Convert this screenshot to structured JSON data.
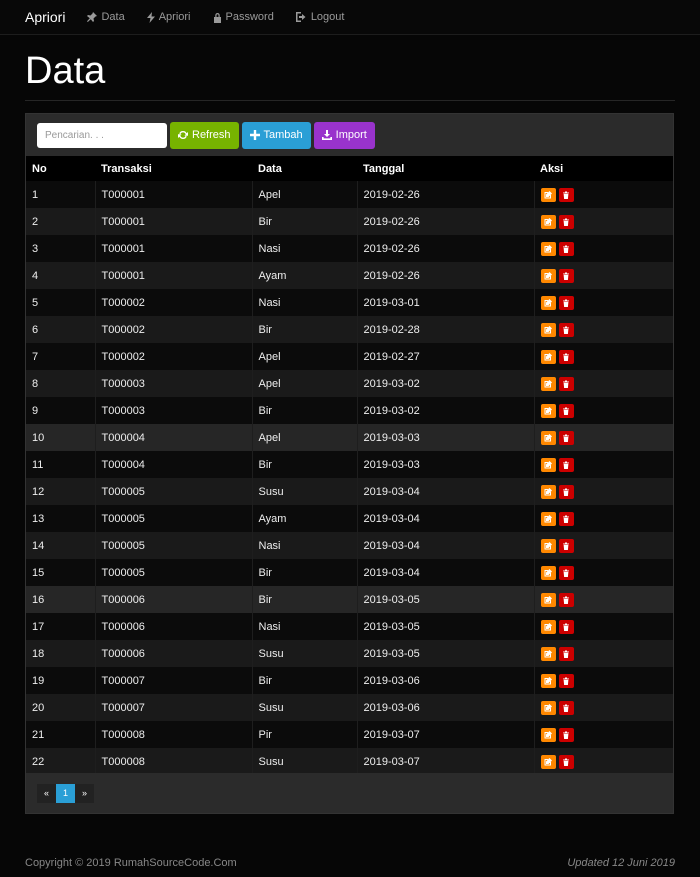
{
  "nav": {
    "brand": "Apriori",
    "items": [
      {
        "label": "Data",
        "icon": "pin-icon"
      },
      {
        "label": "Apriori",
        "icon": "flash-icon"
      },
      {
        "label": "Password",
        "icon": "lock-icon"
      },
      {
        "label": "Logout",
        "icon": "logout-icon"
      }
    ]
  },
  "page": {
    "title": "Data"
  },
  "toolbar": {
    "search_placeholder": "Pencarian. . .",
    "refresh_label": "Refresh",
    "tambah_label": "Tambah",
    "import_label": "Import"
  },
  "table": {
    "headers": [
      "No",
      "Transaksi",
      "Data",
      "Tanggal",
      "Aksi"
    ],
    "rows": [
      [
        "1",
        "T000001",
        "Apel",
        "2019-02-26"
      ],
      [
        "2",
        "T000001",
        "Bir",
        "2019-02-26"
      ],
      [
        "3",
        "T000001",
        "Nasi",
        "2019-02-26"
      ],
      [
        "4",
        "T000001",
        "Ayam",
        "2019-02-26"
      ],
      [
        "5",
        "T000002",
        "Nasi",
        "2019-03-01"
      ],
      [
        "6",
        "T000002",
        "Bir",
        "2019-02-28"
      ],
      [
        "7",
        "T000002",
        "Apel",
        "2019-02-27"
      ],
      [
        "8",
        "T000003",
        "Apel",
        "2019-03-02"
      ],
      [
        "9",
        "T000003",
        "Bir",
        "2019-03-02"
      ],
      [
        "10",
        "T000004",
        "Apel",
        "2019-03-03"
      ],
      [
        "11",
        "T000004",
        "Bir",
        "2019-03-03"
      ],
      [
        "12",
        "T000005",
        "Susu",
        "2019-03-04"
      ],
      [
        "13",
        "T000005",
        "Ayam",
        "2019-03-04"
      ],
      [
        "14",
        "T000005",
        "Nasi",
        "2019-03-04"
      ],
      [
        "15",
        "T000005",
        "Bir",
        "2019-03-04"
      ],
      [
        "16",
        "T000006",
        "Bir",
        "2019-03-05"
      ],
      [
        "17",
        "T000006",
        "Nasi",
        "2019-03-05"
      ],
      [
        "18",
        "T000006",
        "Susu",
        "2019-03-05"
      ],
      [
        "19",
        "T000007",
        "Bir",
        "2019-03-06"
      ],
      [
        "20",
        "T000007",
        "Susu",
        "2019-03-06"
      ],
      [
        "21",
        "T000008",
        "Pir",
        "2019-03-07"
      ],
      [
        "22",
        "T000008",
        "Susu",
        "2019-03-07"
      ]
    ],
    "highlighted_rows": [
      10,
      16
    ]
  },
  "pagination": {
    "prev": "«",
    "current": "1",
    "next": "»"
  },
  "footer": {
    "copyright": "Copyright © 2019 RumahSourceCode.Com",
    "updated": "Updated 12 Juni 2019"
  }
}
